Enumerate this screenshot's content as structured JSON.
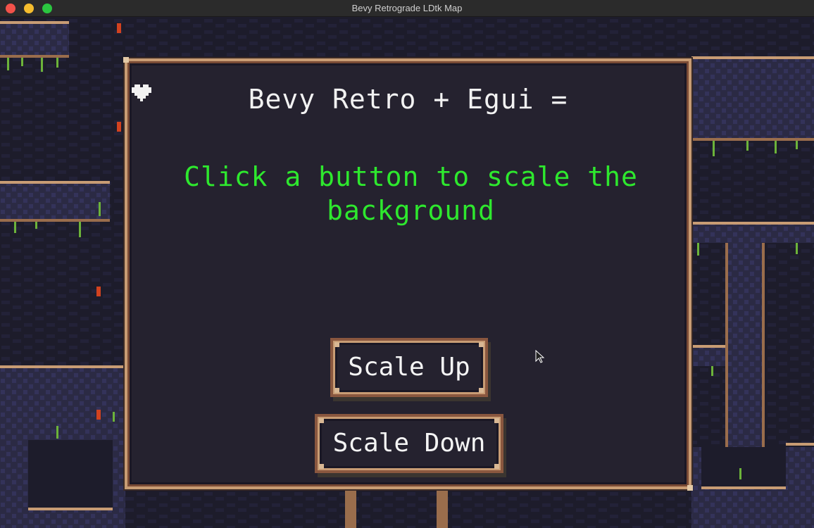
{
  "window": {
    "title": "Bevy Retrograde LDtk Map"
  },
  "dialog": {
    "heading": "Bevy Retro + Egui = ",
    "heading_icon": "heart-icon",
    "message": "Click a button to scale the background"
  },
  "buttons": {
    "scale_up": "Scale Up",
    "scale_down": "Scale Down"
  },
  "colors": {
    "message_green": "#2ee82e",
    "panel_bg": "#25222f",
    "frame_tan": "#c89c74",
    "frame_brown": "#8a573f",
    "tile_bg": "#1d1c2b"
  }
}
